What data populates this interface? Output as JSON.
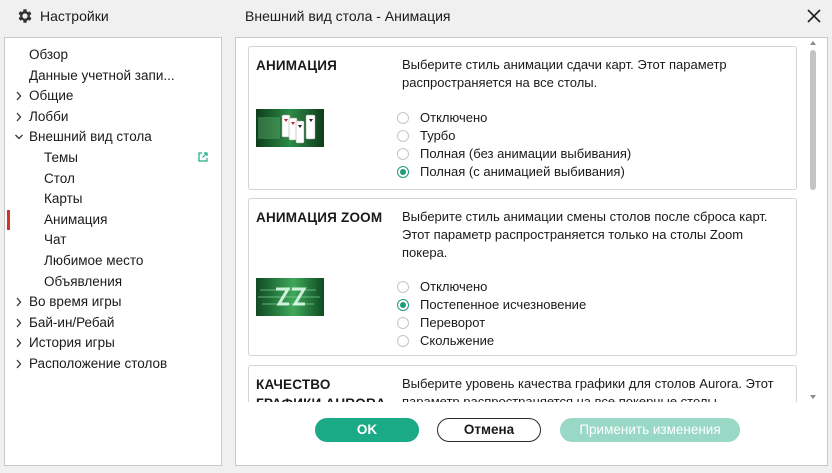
{
  "window": {
    "app_label": "Настройки",
    "title": "Внешний вид стола - Анимация",
    "icons": {
      "app": "gear-icon",
      "close": "close-icon"
    }
  },
  "sidebar": {
    "items": [
      {
        "label": "Обзор",
        "chevron": "",
        "level": 0,
        "active": false
      },
      {
        "label": "Данные учетной запи...",
        "chevron": "",
        "level": 0,
        "active": false
      },
      {
        "label": "Общие",
        "chevron": "right",
        "level": 0,
        "active": false
      },
      {
        "label": "Лобби",
        "chevron": "right",
        "level": 0,
        "active": false
      },
      {
        "label": "Внешний вид стола",
        "chevron": "down",
        "level": 0,
        "active": false
      },
      {
        "label": "Темы",
        "chevron": "",
        "level": 1,
        "active": false,
        "icon": "external-link-icon"
      },
      {
        "label": "Стол",
        "chevron": "",
        "level": 1,
        "active": false
      },
      {
        "label": "Карты",
        "chevron": "",
        "level": 1,
        "active": false
      },
      {
        "label": "Анимация",
        "chevron": "",
        "level": 1,
        "active": true
      },
      {
        "label": "Чат",
        "chevron": "",
        "level": 1,
        "active": false
      },
      {
        "label": "Любимое место",
        "chevron": "",
        "level": 1,
        "active": false
      },
      {
        "label": "Объявления",
        "chevron": "",
        "level": 1,
        "active": false
      },
      {
        "label": "Во время игры",
        "chevron": "right",
        "level": 0,
        "active": false
      },
      {
        "label": "Бай-ин/Ребай",
        "chevron": "right",
        "level": 0,
        "active": false
      },
      {
        "label": "История игры",
        "chevron": "right",
        "level": 0,
        "active": false
      },
      {
        "label": "Расположение столов",
        "chevron": "right",
        "level": 0,
        "active": false
      }
    ],
    "active_color": "#d0342c"
  },
  "sections": [
    {
      "title": "АНИМАЦИЯ",
      "description": "Выберите стиль анимации сдачи карт. Этот параметр распространяется на все столы.",
      "thumbnail_icon": "cards-animation-thumbnail",
      "options": [
        {
          "label": "Отключено",
          "checked": false
        },
        {
          "label": "Турбо",
          "checked": false
        },
        {
          "label": "Полная (без анимации выбивания)",
          "checked": false
        },
        {
          "label": "Полная (с анимацией выбивания)",
          "checked": true
        }
      ]
    },
    {
      "title": "АНИМАЦИЯ ZOOM",
      "description": "Выберите стиль анимации смены столов после сброса карт. Этот параметр распространяется только на столы Zoom покера.",
      "thumbnail_icon": "zoom-logo-thumbnail",
      "options": [
        {
          "label": "Отключено",
          "checked": false
        },
        {
          "label": "Постепенное исчезновение",
          "checked": true
        },
        {
          "label": "Переворот",
          "checked": false
        },
        {
          "label": "Скольжение",
          "checked": false
        }
      ]
    },
    {
      "title": "КАЧЕСТВО ГРАФИКИ AURORA",
      "description": "Выберите уровень качества графики для столов Aurora. Этот параметр распространяется на все покерные столы."
    }
  ],
  "footer": {
    "ok_label": "OK",
    "cancel_label": "Отмена",
    "apply_label": "Применить изменения"
  },
  "colors": {
    "accent": "#1aaa86",
    "accent_disabled": "#9ad8c6",
    "radio_checked": "#1f9b78"
  }
}
